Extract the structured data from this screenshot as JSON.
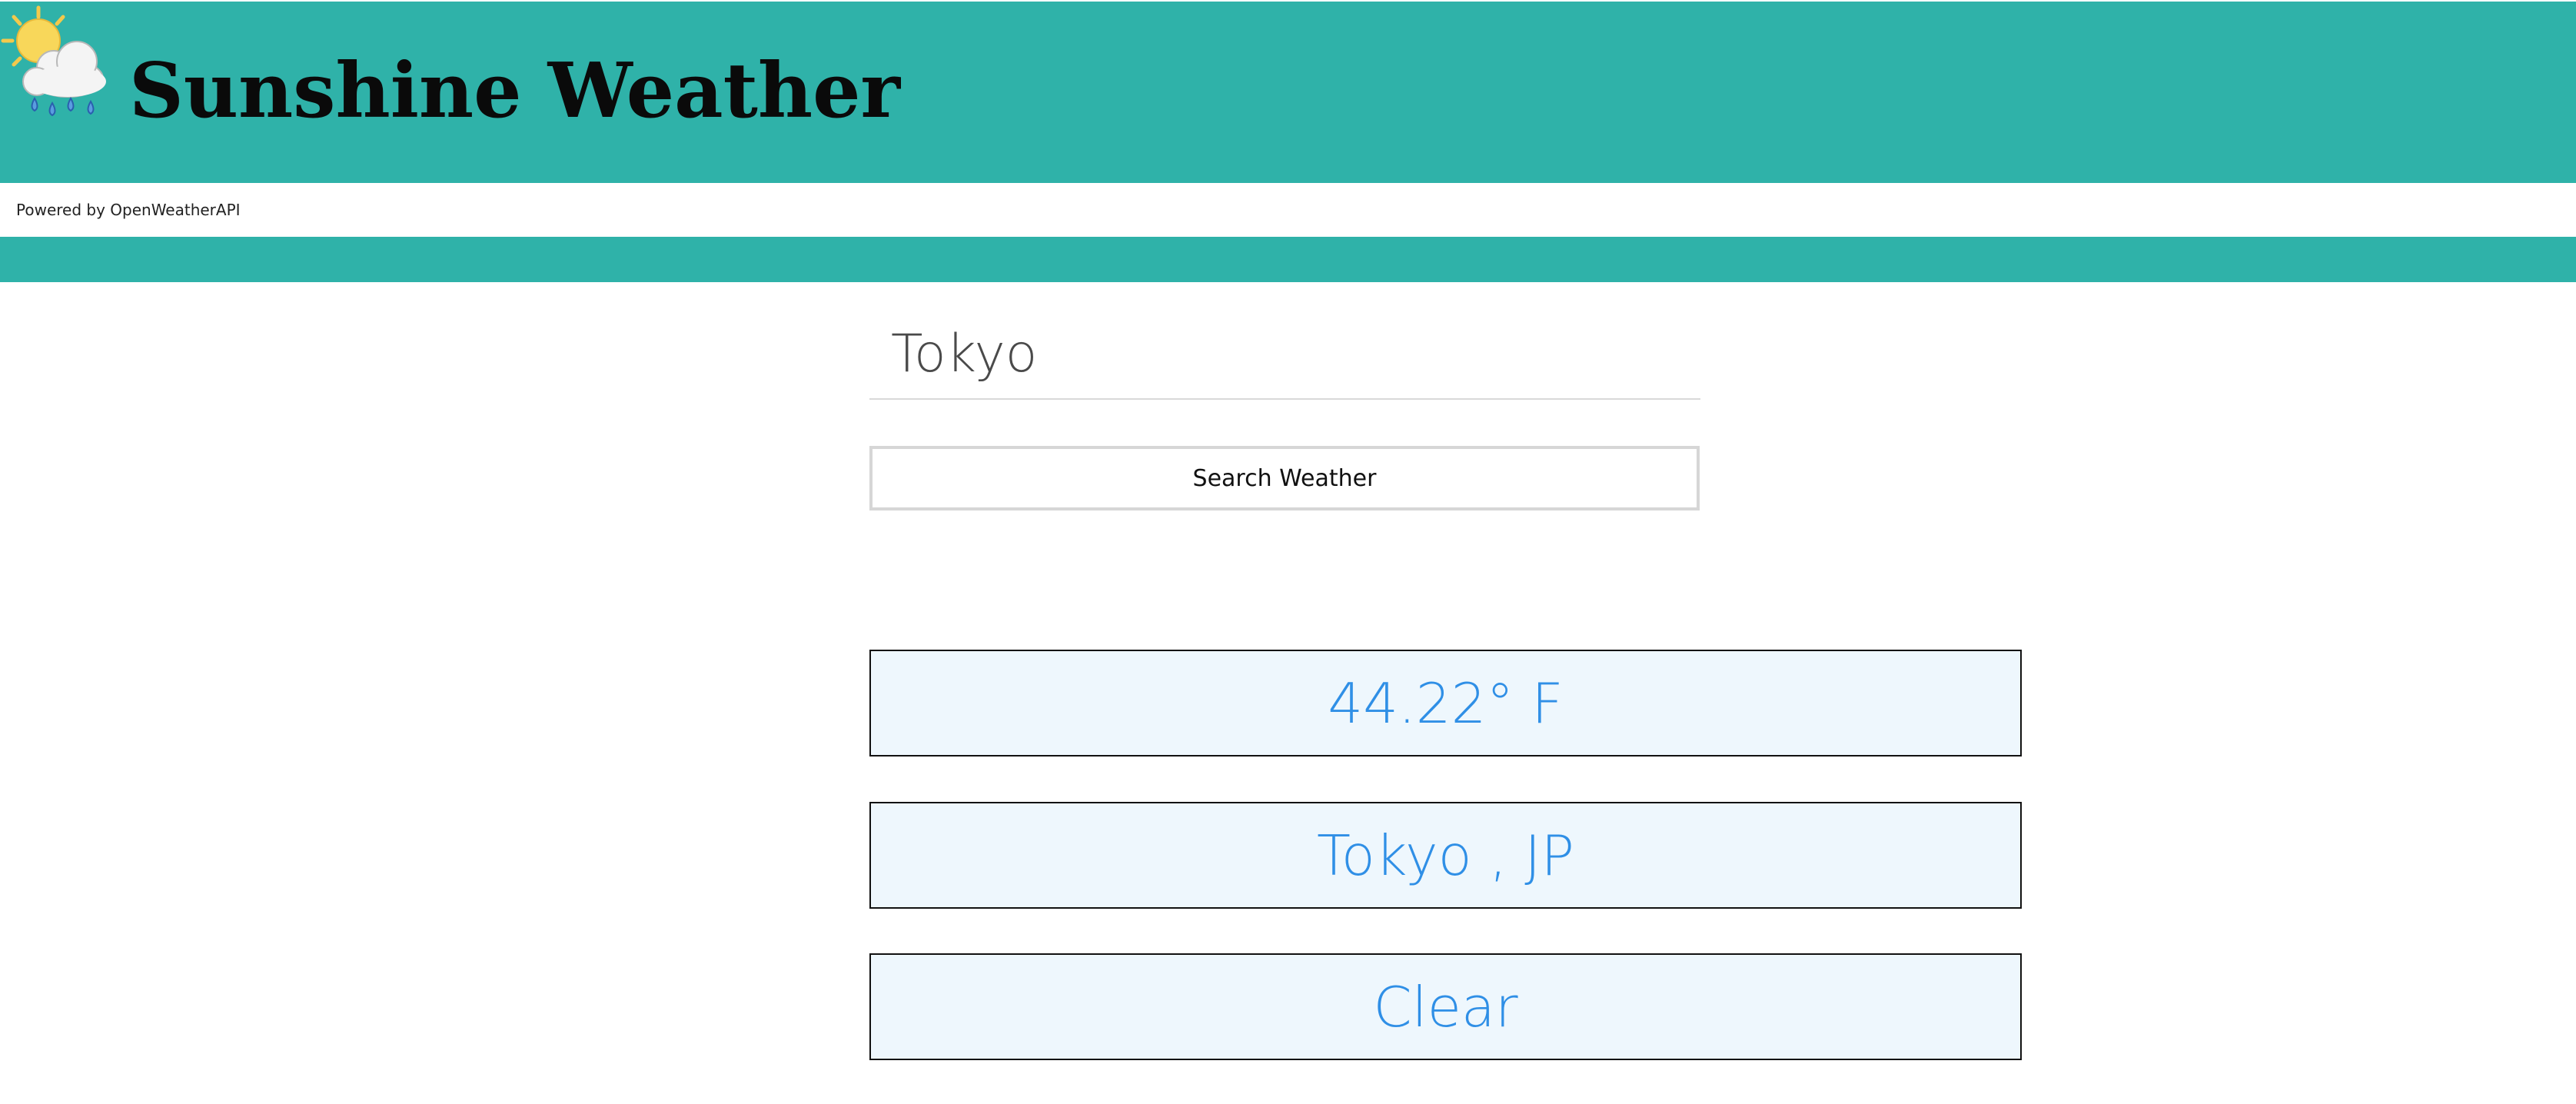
{
  "header": {
    "title": "Sunshine Weather",
    "logo_icon": "sun-behind-rain-cloud-icon",
    "background_color": "#2fb2a9"
  },
  "powered_by": {
    "text": "Powered by OpenWeatherAPI"
  },
  "search": {
    "city_value": "Tokyo",
    "button_label": "Search Weather"
  },
  "results": {
    "temperature": "44.22° F",
    "location": "Tokyo , JP",
    "condition": "Clear",
    "text_color": "#2f8fe6",
    "box_background": "#eef7fd"
  }
}
